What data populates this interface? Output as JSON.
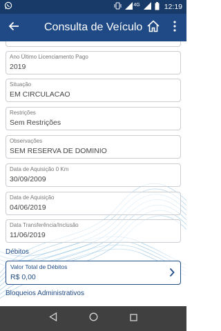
{
  "status_bar": {
    "network": "4G",
    "time": "12:19",
    "icons": [
      "whatsapp-icon",
      "vibrate-icon",
      "signal-icon",
      "battery-icon"
    ]
  },
  "app_bar": {
    "title": "Consulta de Veículo",
    "icons": [
      "back-arrow-icon",
      "home-icon",
      "more-vertical-icon"
    ]
  },
  "fields": [
    {
      "label": "Ano Último Licenciamento Pago",
      "value": "2019"
    },
    {
      "label": "Situação",
      "value": "EM CIRCULACAO"
    },
    {
      "label": "Restrições",
      "value": "Sem Restrições"
    },
    {
      "label": "Observações",
      "value": "SEM RESERVA DE DOMINIO"
    },
    {
      "label": "Data de Aquisição 0 Km",
      "value": "30/09/2009"
    },
    {
      "label": "Data de Aquisição",
      "value": "04/06/2019"
    },
    {
      "label": "Data Transferência/Inclusão",
      "value": "11/06/2019"
    }
  ],
  "debitos": {
    "section_title": "Débitos",
    "card_label": "Valor Total de Débitos",
    "card_value": "R$ 0,00"
  },
  "bloqueios": {
    "section_title": "Bloqueios Administrativos"
  },
  "colors": {
    "primary": "#1f4a85",
    "status_bar": "#173a68",
    "nav_bar": "#404040"
  }
}
